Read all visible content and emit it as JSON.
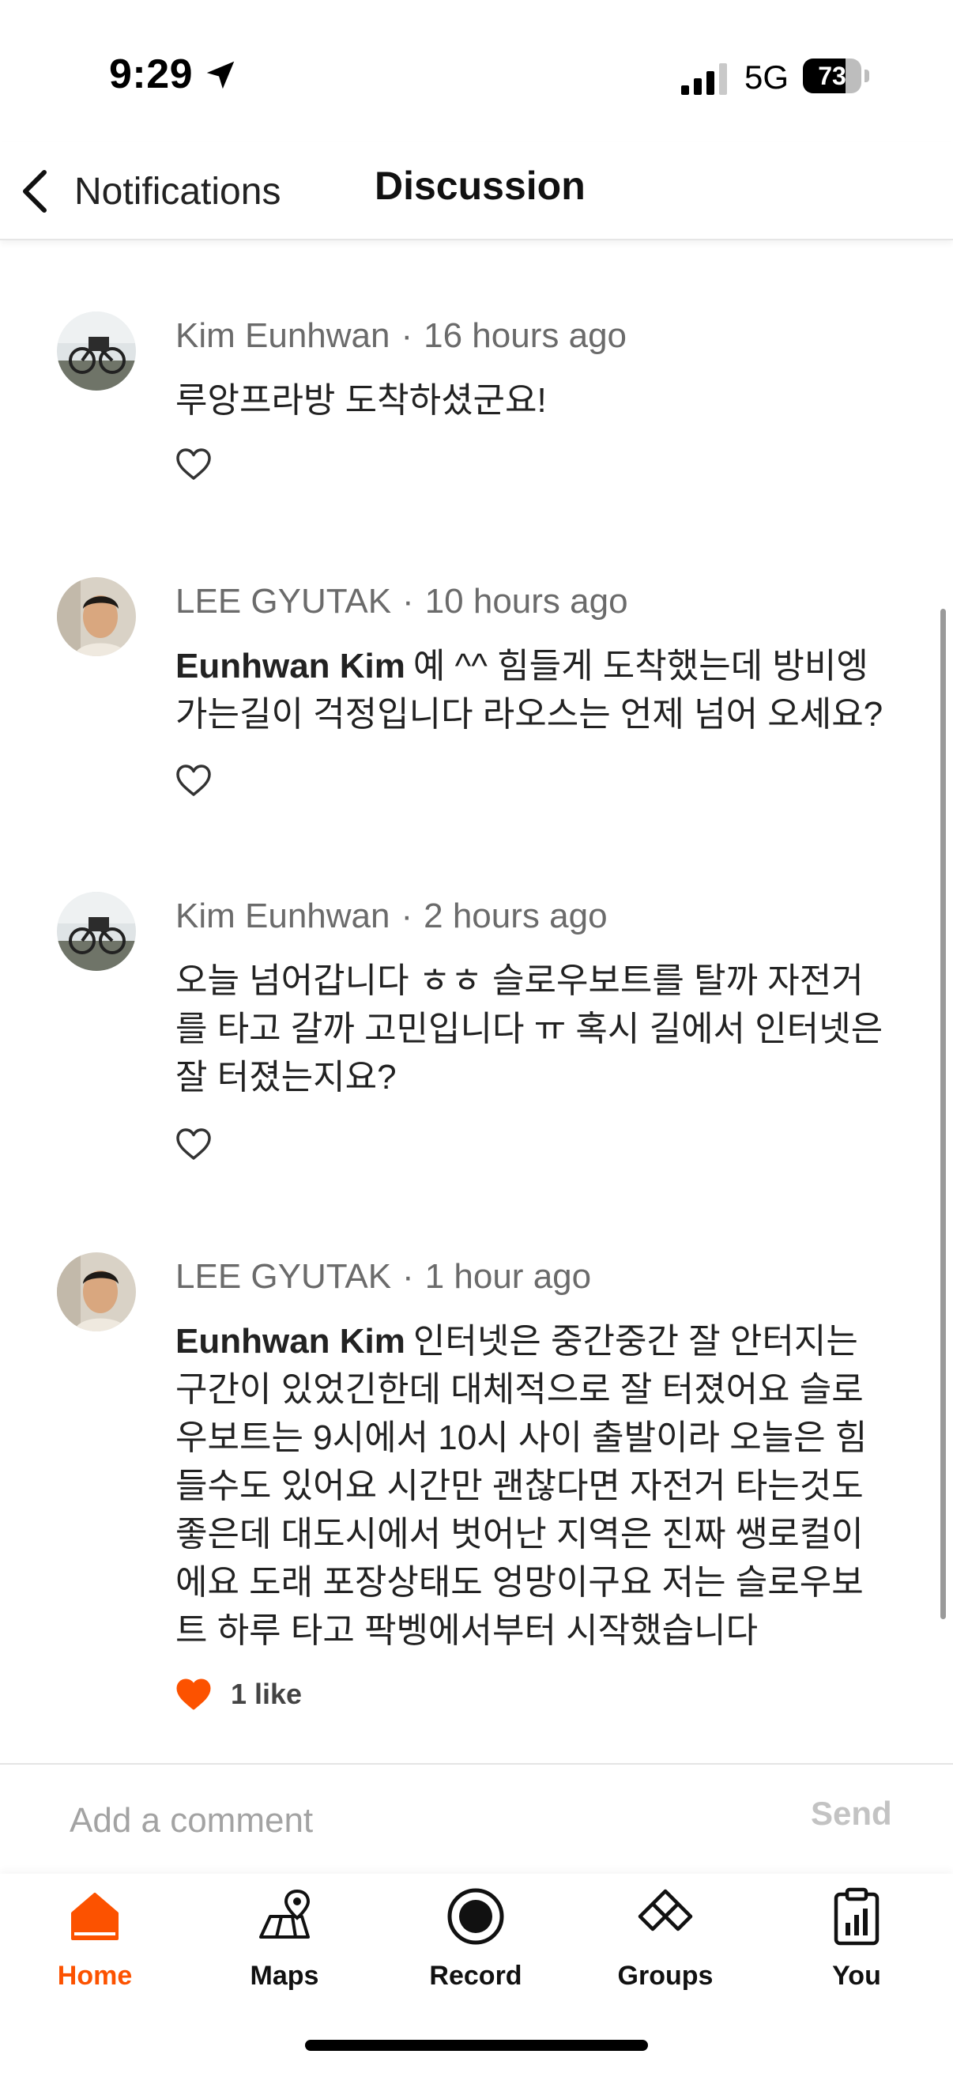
{
  "status_bar": {
    "time": "9:29",
    "network": "5G",
    "battery_level": 73,
    "battery_text": "73"
  },
  "nav": {
    "back_label": "Notifications",
    "title": "Discussion"
  },
  "comments": [
    {
      "author": "Kim Eunhwan",
      "time": "16 hours ago",
      "mention": "",
      "text": "루앙프라방 도착하셨군요!",
      "likes_text": "",
      "liked": false
    },
    {
      "author": "LEE GYUTAK",
      "time": "10 hours ago",
      "mention": "Eunhwan Kim",
      "text": "예 ^^ 힘들게 도착했는데 방비엥 가는길이 걱정입니다 라오스는 언제 넘어 오세요?",
      "likes_text": "",
      "liked": false
    },
    {
      "author": "Kim Eunhwan",
      "time": "2 hours ago",
      "mention": "",
      "text": "오늘 넘어갑니다 ㅎㅎ 슬로우보트를 탈까 자전거를 타고 갈까 고민입니다 ㅠ 혹시 길에서 인터넷은 잘 터졌는지요?",
      "likes_text": "",
      "liked": false
    },
    {
      "author": "LEE GYUTAK",
      "time": "1 hour ago",
      "mention": "Eunhwan Kim",
      "text": "인터넷은 중간중간 잘 안터지는 구간이 있었긴한데 대체적으로 잘 터졌어요 슬로우보트는 9시에서 10시 사이 출발이라 오늘은 힘들수도 있어요 시간만 괜찮다면 자전거 타는것도 좋은데 대도시에서 벗어난 지역은 진짜 쌩로컬이에요 도래 포장상태도 엉망이구요 저는 슬로우보트 하루 타고 팍벵에서부터 시작했습니다",
      "likes_text": "1 like",
      "liked": true
    }
  ],
  "comment_bar": {
    "placeholder": "Add a comment",
    "send_label": "Send"
  },
  "tabs": [
    {
      "label": "Home",
      "icon": "home-icon",
      "active": true
    },
    {
      "label": "Maps",
      "icon": "map-icon",
      "active": false
    },
    {
      "label": "Record",
      "icon": "record-icon",
      "active": false
    },
    {
      "label": "Groups",
      "icon": "groups-icon",
      "active": false
    },
    {
      "label": "You",
      "icon": "profile-clipboard-icon",
      "active": false
    }
  ],
  "colors": {
    "accent": "#fc5200",
    "text": "#222222",
    "meta": "#6b6b6b"
  }
}
